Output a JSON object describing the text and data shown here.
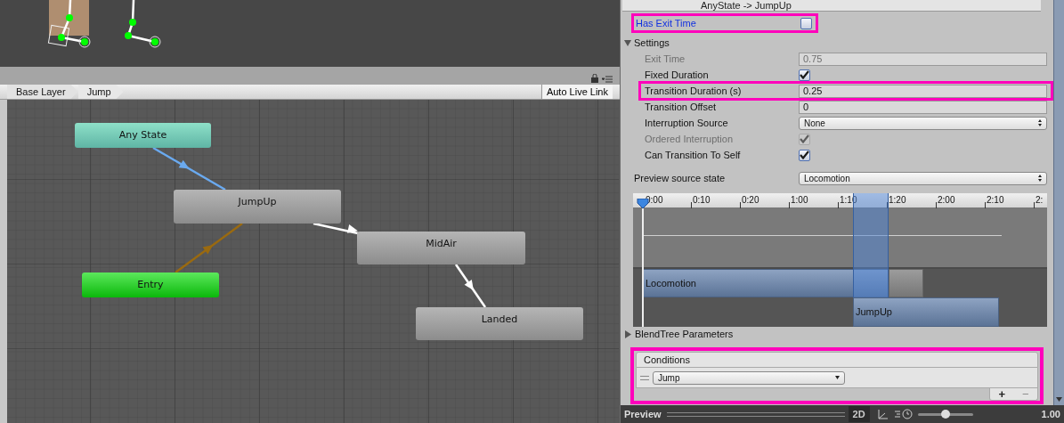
{
  "breadcrumb": {
    "items": [
      {
        "label": "Base Layer"
      },
      {
        "label": "Jump"
      }
    ],
    "auto_live_link": "Auto Live Link"
  },
  "graph": {
    "nodes": [
      {
        "label": "Any State",
        "kind": "any"
      },
      {
        "label": "JumpUp",
        "kind": "state"
      },
      {
        "label": "MidAir",
        "kind": "state"
      },
      {
        "label": "Entry",
        "kind": "entry"
      },
      {
        "label": "Landed",
        "kind": "state"
      }
    ],
    "edges": [
      {
        "kind": "transition",
        "selected": true
      },
      {
        "kind": "entry",
        "selected": false
      },
      {
        "kind": "transition",
        "selected": false
      },
      {
        "kind": "transition",
        "selected": false
      }
    ]
  },
  "inspector": {
    "header": "AnyState -> JumpUp",
    "has_exit_time": {
      "label": "Has Exit Time",
      "checked": false,
      "highlighted": true,
      "annotated": true
    },
    "settings": {
      "label": "Settings",
      "expanded": true,
      "fields": [
        {
          "kind": "number",
          "label": "Exit Time",
          "value": "0.75",
          "disabled": true,
          "annotated": false
        },
        {
          "kind": "checkbox",
          "label": "Fixed Duration",
          "checked": true,
          "disabled": false,
          "annotated": false
        },
        {
          "kind": "number",
          "label": "Transition Duration (s)",
          "value": "0.25",
          "disabled": false,
          "annotated": true
        },
        {
          "kind": "number",
          "label": "Transition Offset",
          "value": "0",
          "disabled": false,
          "annotated": false
        },
        {
          "kind": "dropdown",
          "label": "Interruption Source",
          "value": "None",
          "disabled": false,
          "annotated": false
        },
        {
          "kind": "checkbox",
          "label": "Ordered Interruption",
          "checked": true,
          "disabled": true,
          "annotated": false
        },
        {
          "kind": "checkbox",
          "label": "Can Transition To Self",
          "checked": true,
          "disabled": false,
          "annotated": false
        }
      ]
    },
    "preview_source": {
      "label": "Preview source state",
      "value": "Locomotion"
    },
    "timeline": {
      "ticks": [
        "0:00",
        "0:10",
        "0:20",
        "1:00",
        "1:10",
        "1:20",
        "2:00",
        "2:10",
        "2:"
      ],
      "clips": [
        {
          "label": "Locomotion"
        },
        {
          "label": "JumpUp"
        }
      ]
    },
    "blendtree": {
      "label": "BlendTree Parameters",
      "expanded": false
    },
    "conditions": {
      "title": "Conditions",
      "annotated": true,
      "items": [
        {
          "parameter": "Jump"
        }
      ],
      "add": "+",
      "remove": "−"
    }
  },
  "preview_bar": {
    "title": "Preview",
    "mode": "2D",
    "speed": {
      "level": 0.5,
      "reading": "1.00"
    }
  }
}
